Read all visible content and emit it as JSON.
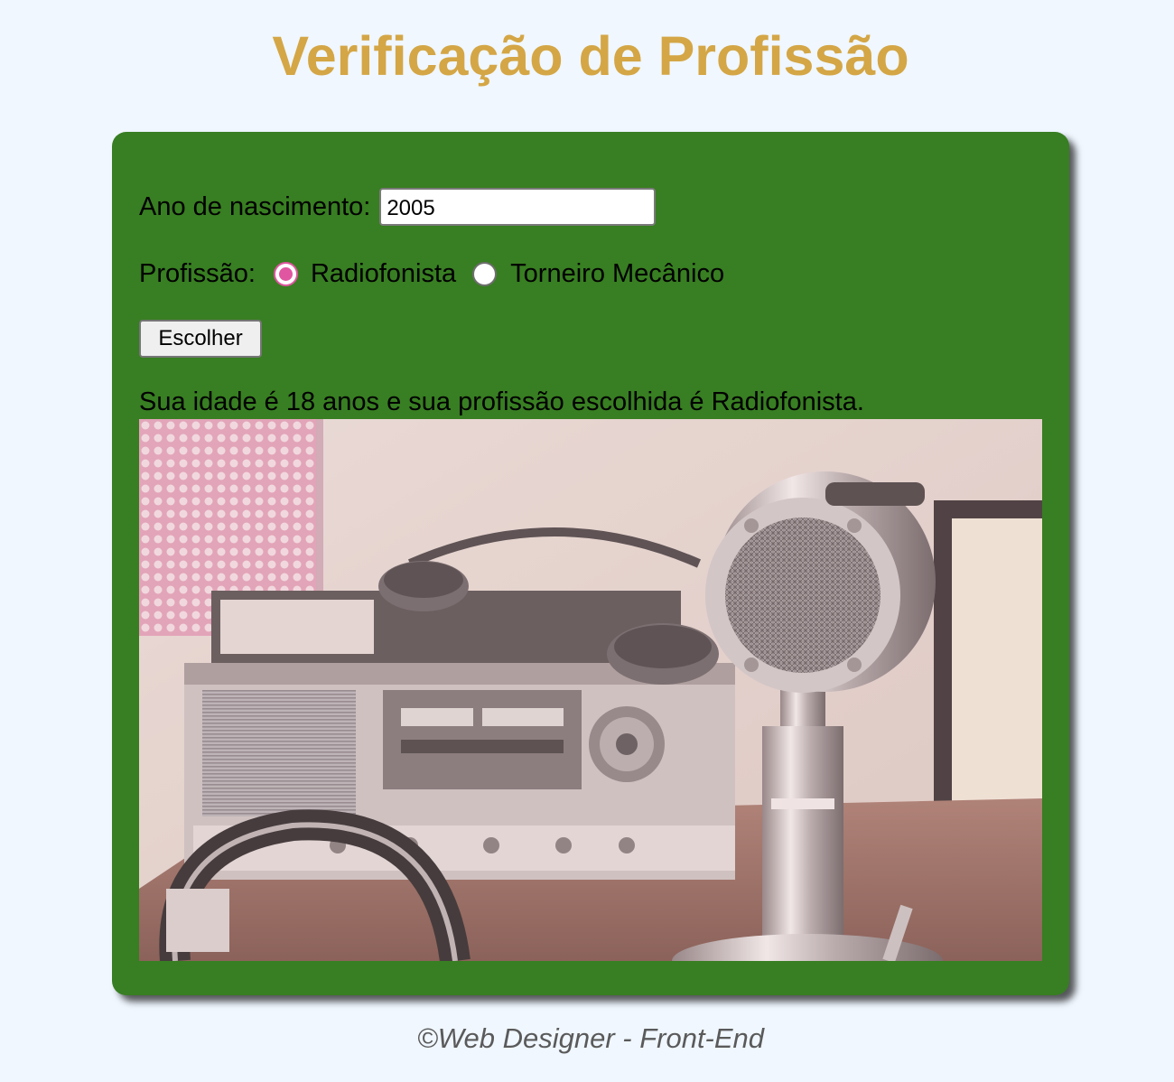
{
  "header": {
    "title": "Verificação de Profissão"
  },
  "form": {
    "birth_label": "Ano de nascimento:",
    "birth_value": "2005",
    "profession_label": "Profissão:",
    "options": [
      {
        "label": "Radiofonista",
        "checked": true
      },
      {
        "label": "Torneiro Mecânico",
        "checked": false
      }
    ],
    "choose_label": "Escolher"
  },
  "result": {
    "text": "Sua idade é 18 anos e sua profissão escolhida é Radiofonista."
  },
  "footer": {
    "text": "©Web Designer - Front-End"
  },
  "colors": {
    "page_background": "#f0f7ff",
    "title": "#d4a645",
    "card_background": "#387e22",
    "radio_accent": "#e056a0",
    "footer_text": "#5a5a5a"
  },
  "image": {
    "subject": "vintage ham radio transceiver with desk microphone and headphones"
  }
}
